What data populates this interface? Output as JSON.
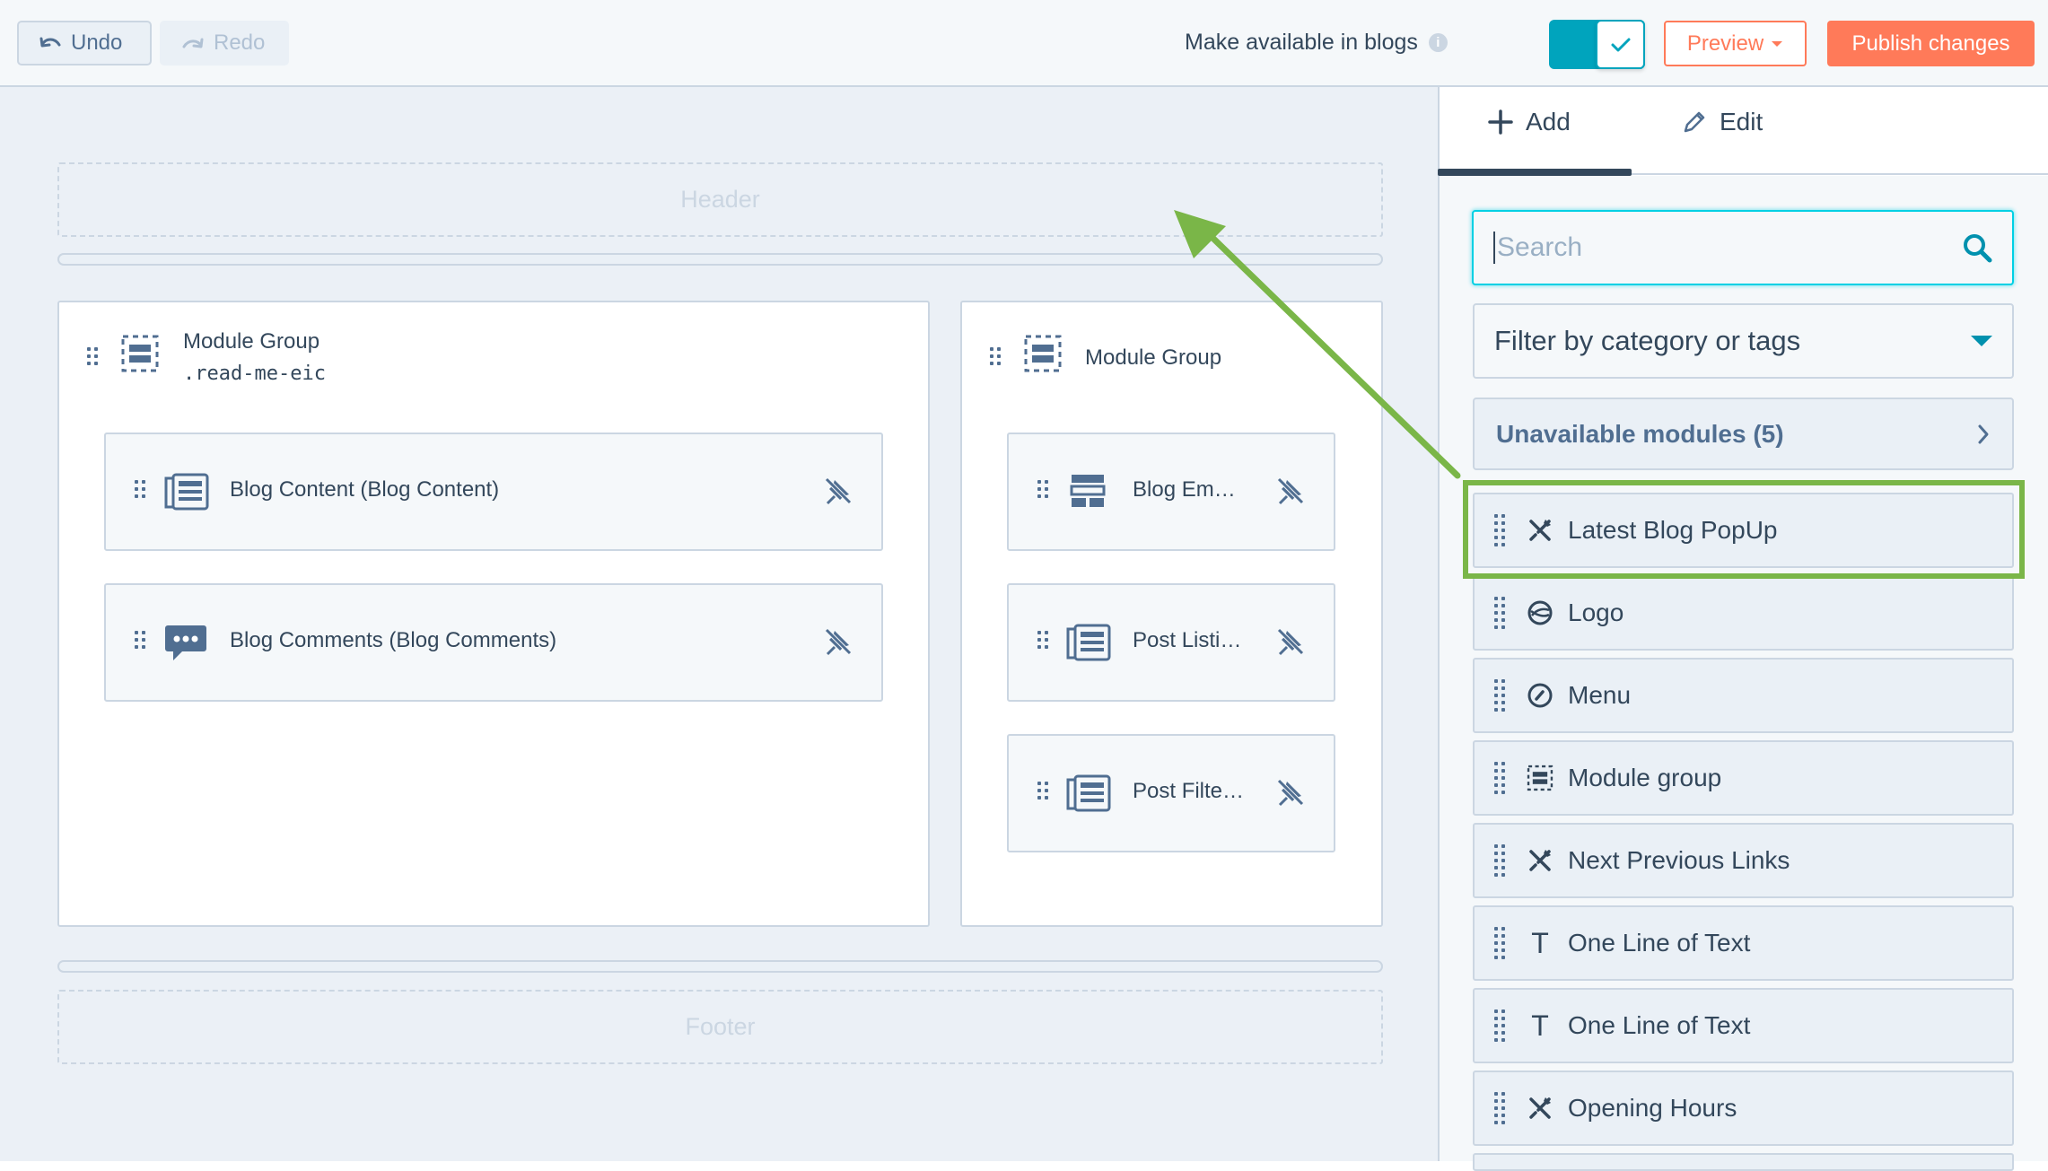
{
  "toolbar": {
    "undo_label": "Undo",
    "redo_label": "Redo",
    "make_available_label": "Make available in blogs",
    "info_glyph": "i",
    "preview_label": "Preview",
    "publish_label": "Publish changes",
    "toggle_on": true
  },
  "canvas": {
    "header_label": "Header",
    "footer_label": "Footer",
    "groups": [
      {
        "title": "Module Group",
        "class_name": ".read-me-eic",
        "modules": [
          {
            "label": "Blog Content (Blog Content)",
            "icon": "blog-content-icon"
          },
          {
            "label": "Blog Comments (Blog Comments)",
            "icon": "comments-icon"
          }
        ]
      },
      {
        "title": "Module Group",
        "modules": [
          {
            "label": "Blog Em…",
            "icon": "blog-email-icon"
          },
          {
            "label": "Post Listi…",
            "icon": "blog-content-icon"
          },
          {
            "label": "Post Filte…",
            "icon": "blog-content-icon"
          }
        ]
      }
    ]
  },
  "panel": {
    "tabs": [
      {
        "label": "Add",
        "icon": "plus-icon",
        "active": true
      },
      {
        "label": "Edit",
        "icon": "pencil-icon",
        "active": false
      }
    ],
    "search_placeholder": "Search",
    "filter_label": "Filter by category or tags",
    "unavailable_label": "Unavailable modules (5)",
    "modules": [
      {
        "label": "Latest Blog PopUp",
        "icon": "tools-icon",
        "highlighted": true
      },
      {
        "label": "Logo",
        "icon": "logo-icon"
      },
      {
        "label": "Menu",
        "icon": "compass-icon"
      },
      {
        "label": "Module group",
        "icon": "module-group-icon"
      },
      {
        "label": "Next Previous Links",
        "icon": "tools-icon"
      },
      {
        "label": "One Line of Text",
        "icon": "text-icon",
        "glyph": "T"
      },
      {
        "label": "One Line of Text",
        "icon": "text-icon",
        "glyph": "T"
      },
      {
        "label": "Opening Hours",
        "icon": "tools-icon"
      }
    ]
  },
  "colors": {
    "accent_orange": "#ff7a59",
    "toggle_teal": "#00a4bd",
    "annotation_green": "#7ab648"
  }
}
